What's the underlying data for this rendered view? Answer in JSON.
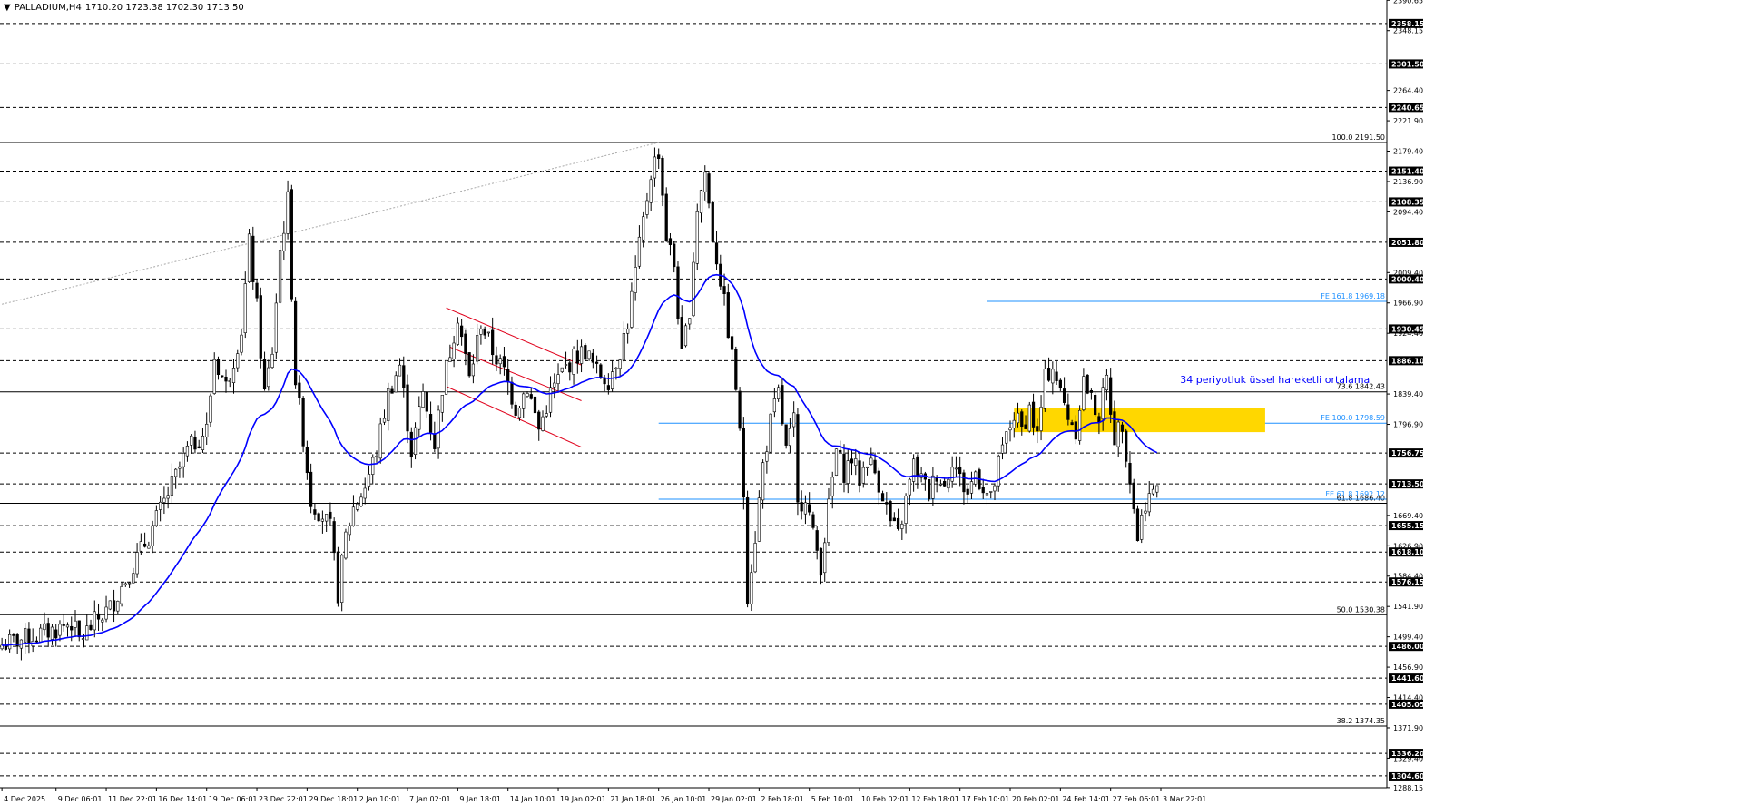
{
  "header": {
    "arrow": "▼",
    "symbol": "PALLADIUM,H4",
    "ohlc": "1710.20 1723.38 1702.30 1713.50"
  },
  "colors": {
    "background": "#ffffff",
    "candle": "#000000",
    "ema": "#0000ff",
    "fib_line": "#000000",
    "fe_line": "#1e90ff",
    "channel": "#e0001b",
    "zone": "#ffd700",
    "trend": "#aaaaaa",
    "dashed": "#000000"
  },
  "chart_data": {
    "type": "candlestick",
    "ylim": [
      1288.0,
      2391.0
    ],
    "x_count": 359,
    "y_tick_labels": [
      "2390.65",
      "2348.15",
      "2264.40",
      "2221.90",
      "2179.40",
      "2136.90",
      "2094.40",
      "2009.40",
      "1966.90",
      "1924.40",
      "1839.40",
      "1796.90",
      "1669.40",
      "1626.90",
      "1584.40",
      "1541.90",
      "1499.40",
      "1456.90",
      "1414.40",
      "1371.90",
      "1329.40",
      "1288.15"
    ],
    "price_levels": [
      {
        "price": 2358.15,
        "label": "2358.15"
      },
      {
        "price": 2301.5,
        "label": "2301.50"
      },
      {
        "price": 2240.65,
        "label": "2240.65"
      },
      {
        "price": 2151.4,
        "label": "2151.40"
      },
      {
        "price": 2108.35,
        "label": "2108.35"
      },
      {
        "price": 2051.8,
        "label": "2051.80"
      },
      {
        "price": 2000.4,
        "label": "2000.40"
      },
      {
        "price": 1930.45,
        "label": "1930.45"
      },
      {
        "price": 1886.1,
        "label": "1886.10"
      },
      {
        "price": 1756.75,
        "label": "1756.75"
      },
      {
        "price": 1713.5,
        "label": "1713.50"
      },
      {
        "price": 1655.15,
        "label": "1655.15"
      },
      {
        "price": 1618.1,
        "label": "1618.10"
      },
      {
        "price": 1576.15,
        "label": "1576.15"
      },
      {
        "price": 1486.0,
        "label": "1486.00"
      },
      {
        "price": 1441.6,
        "label": "1441.60"
      },
      {
        "price": 1405.05,
        "label": "1405.05"
      },
      {
        "price": 1336.2,
        "label": "1336.20"
      },
      {
        "price": 1304.6,
        "label": "1304.60"
      }
    ],
    "fib_levels": [
      {
        "price": 2191.5,
        "label": "100.0 2191.50"
      },
      {
        "price": 1842.43,
        "label": "73.6 1842.43"
      },
      {
        "price": 1686.4,
        "label": "61.8 1686.40"
      },
      {
        "price": 1530.38,
        "label": "50.0 1530.38"
      },
      {
        "price": 1374.35,
        "label": "38.2 1374.35"
      }
    ],
    "fe_levels": [
      {
        "price": 1969.18,
        "label": "FE 161.8 1969.18",
        "x_start": 255
      },
      {
        "price": 1798.59,
        "label": "FE 100.0 1798.59",
        "x_start": 170
      },
      {
        "price": 1692.12,
        "label": "FE 61.8 1692.12",
        "x_start": 170
      }
    ],
    "x_labels": [
      {
        "i": 0,
        "label": "4 Dec 2025"
      },
      {
        "i": 14,
        "label": "9 Dec 06:01"
      },
      {
        "i": 27,
        "label": "11 Dec 22:01"
      },
      {
        "i": 40,
        "label": "16 Dec 14:01"
      },
      {
        "i": 53,
        "label": "19 Dec 06:01"
      },
      {
        "i": 66,
        "label": "23 Dec 22:01"
      },
      {
        "i": 79,
        "label": "29 Dec 18:01"
      },
      {
        "i": 92,
        "label": "2 Jan 10:01"
      },
      {
        "i": 105,
        "label": "7 Jan 02:01"
      },
      {
        "i": 118,
        "label": "9 Jan 18:01"
      },
      {
        "i": 131,
        "label": "14 Jan 10:01"
      },
      {
        "i": 144,
        "label": "19 Jan 02:01"
      },
      {
        "i": 157,
        "label": "21 Jan 18:01"
      },
      {
        "i": 170,
        "label": "26 Jan 10:01"
      },
      {
        "i": 183,
        "label": "29 Jan 02:01"
      },
      {
        "i": 196,
        "label": "2 Feb 18:01"
      },
      {
        "i": 209,
        "label": "5 Feb 10:01"
      },
      {
        "i": 222,
        "label": "10 Feb 02:01"
      },
      {
        "i": 235,
        "label": "12 Feb 18:01"
      },
      {
        "i": 248,
        "label": "17 Feb 10:01"
      },
      {
        "i": 261,
        "label": "20 Feb 02:01"
      },
      {
        "i": 274,
        "label": "24 Feb 14:01"
      },
      {
        "i": 287,
        "label": "27 Feb 06:01"
      },
      {
        "i": 300,
        "label": "3 Mar 22:01"
      }
    ],
    "annotation": "34 periyotluk üssel hareketli ortalama",
    "anchors": [
      [
        0,
        1488
      ],
      [
        8,
        1500
      ],
      [
        14,
        1510
      ],
      [
        18,
        1520
      ],
      [
        20,
        1495
      ],
      [
        24,
        1520
      ],
      [
        28,
        1540
      ],
      [
        33,
        1590
      ],
      [
        38,
        1640
      ],
      [
        43,
        1700
      ],
      [
        48,
        1760
      ],
      [
        53,
        1790
      ],
      [
        55,
        1890
      ],
      [
        58,
        1850
      ],
      [
        62,
        1930
      ],
      [
        64,
        2050
      ],
      [
        66,
        1960
      ],
      [
        68,
        1840
      ],
      [
        70,
        1900
      ],
      [
        72,
        2040
      ],
      [
        74,
        2110
      ],
      [
        76,
        1860
      ],
      [
        78,
        1780
      ],
      [
        80,
        1690
      ],
      [
        83,
        1670
      ],
      [
        85,
        1650
      ],
      [
        87,
        1560
      ],
      [
        89,
        1640
      ],
      [
        91,
        1680
      ],
      [
        94,
        1710
      ],
      [
        97,
        1760
      ],
      [
        100,
        1840
      ],
      [
        103,
        1880
      ],
      [
        106,
        1760
      ],
      [
        109,
        1840
      ],
      [
        112,
        1770
      ],
      [
        114,
        1850
      ],
      [
        116,
        1900
      ],
      [
        118,
        1950
      ],
      [
        121,
        1860
      ],
      [
        124,
        1940
      ],
      [
        127,
        1900
      ],
      [
        130,
        1870
      ],
      [
        133,
        1820
      ],
      [
        136,
        1850
      ],
      [
        139,
        1790
      ],
      [
        142,
        1840
      ],
      [
        145,
        1870
      ],
      [
        148,
        1890
      ],
      [
        151,
        1900
      ],
      [
        154,
        1870
      ],
      [
        157,
        1860
      ],
      [
        160,
        1900
      ],
      [
        162,
        1940
      ],
      [
        164,
        2010
      ],
      [
        166,
        2080
      ],
      [
        168,
        2150
      ],
      [
        170,
        2180
      ],
      [
        172,
        2060
      ],
      [
        174,
        2020
      ],
      [
        176,
        1890
      ],
      [
        178,
        1960
      ],
      [
        180,
        2100
      ],
      [
        182,
        2150
      ],
      [
        184,
        2060
      ],
      [
        186,
        2000
      ],
      [
        188,
        1930
      ],
      [
        190,
        1850
      ],
      [
        191,
        1780
      ],
      [
        192,
        1700
      ],
      [
        193,
        1560
      ],
      [
        195,
        1640
      ],
      [
        197,
        1740
      ],
      [
        199,
        1800
      ],
      [
        201,
        1840
      ],
      [
        203,
        1760
      ],
      [
        205,
        1800
      ],
      [
        206,
        1680
      ],
      [
        208,
        1700
      ],
      [
        210,
        1640
      ],
      [
        212,
        1600
      ],
      [
        214,
        1680
      ],
      [
        216,
        1760
      ],
      [
        218,
        1730
      ],
      [
        220,
        1750
      ],
      [
        222,
        1720
      ],
      [
        224,
        1750
      ],
      [
        226,
        1730
      ],
      [
        228,
        1700
      ],
      [
        230,
        1660
      ],
      [
        232,
        1640
      ],
      [
        234,
        1690
      ],
      [
        236,
        1740
      ],
      [
        238,
        1720
      ],
      [
        240,
        1700
      ],
      [
        242,
        1730
      ],
      [
        244,
        1710
      ],
      [
        246,
        1750
      ],
      [
        248,
        1720
      ],
      [
        250,
        1700
      ],
      [
        252,
        1730
      ],
      [
        254,
        1710
      ],
      [
        256,
        1690
      ],
      [
        258,
        1740
      ],
      [
        260,
        1780
      ],
      [
        262,
        1810
      ],
      [
        264,
        1790
      ],
      [
        266,
        1820
      ],
      [
        268,
        1780
      ],
      [
        270,
        1860
      ],
      [
        272,
        1880
      ],
      [
        274,
        1840
      ],
      [
        276,
        1810
      ],
      [
        278,
        1790
      ],
      [
        280,
        1860
      ],
      [
        282,
        1830
      ],
      [
        284,
        1810
      ],
      [
        286,
        1860
      ],
      [
        288,
        1780
      ],
      [
        290,
        1800
      ],
      [
        292,
        1720
      ],
      [
        294,
        1640
      ],
      [
        296,
        1690
      ],
      [
        298,
        1700
      ],
      [
        299,
        1713
      ]
    ]
  }
}
